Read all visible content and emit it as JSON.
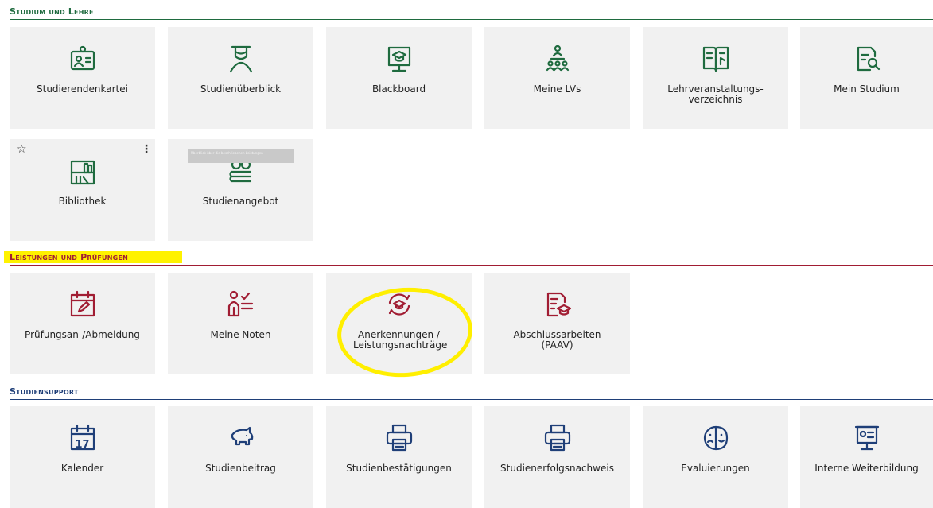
{
  "sections": {
    "studium": {
      "title": "Studium und Lehre",
      "color": "#1f6b3f"
    },
    "leistungen": {
      "title": "Leistungen und Prüfungen",
      "color": "#a11d33"
    },
    "support": {
      "title": "Studiensupport",
      "color": "#1f3f78"
    }
  },
  "tiles": {
    "studierendenkartei": "Studierendenkartei",
    "studienueberblick": "Studienüberblick",
    "blackboard": "Blackboard",
    "meine_lvs": "Meine LVs",
    "lehrveranstaltungsverzeichnis": "Lehrveranstaltungs- verzeichnis",
    "mein_studium": "Mein Studium",
    "bibliothek": "Bibliothek",
    "studienangebot": "Studienangebot",
    "pruefungsanmeldung": "Prüfungsan-/Abmeldung",
    "meine_noten": "Meine Noten",
    "anerkennungen": "Anerkennungen / Leistungsnachträge",
    "abschlussarbeiten": "Abschlussarbeiten (PAAV)",
    "kalender": "Kalender",
    "studienbeitrag": "Studienbeitrag",
    "studienbestaetigungen": "Studienbestätigungen",
    "studienerfolgsnachweis": "Studienerfolgsnachweis",
    "evaluierungen": "Evaluierungen",
    "interne_weiterbildung": "Interne Weiterbildung"
  },
  "calendar_day": "17",
  "tooltip_text": "Überblick über die beschriebenen Leistungen",
  "icons": {
    "star": "star-icon",
    "more": "more-vertical-icon"
  }
}
